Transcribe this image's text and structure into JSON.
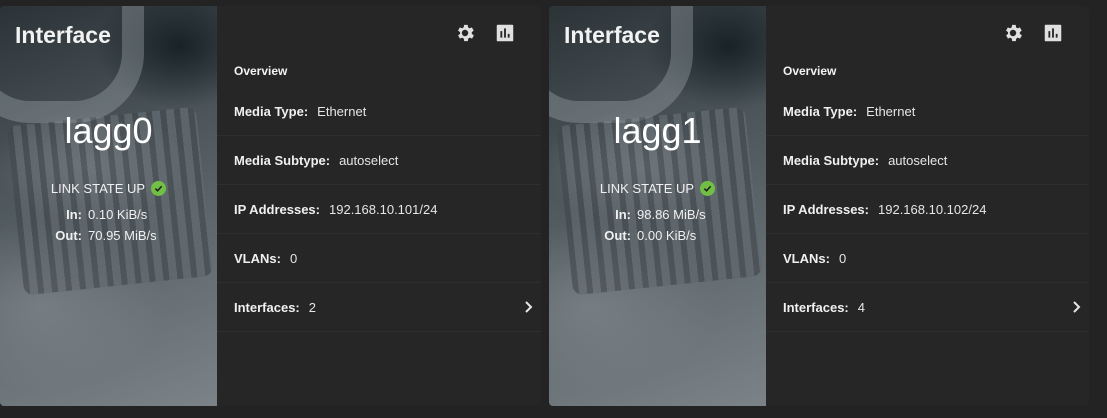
{
  "cards": [
    {
      "title": "Interface",
      "name": "lagg0",
      "link_state": "LINK STATE UP",
      "in_label": "In:",
      "in_value": "0.10 KiB/s",
      "out_label": "Out:",
      "out_value": "70.95 MiB/s",
      "overview": "Overview",
      "media_type_label": "Media Type:",
      "media_type": "Ethernet",
      "media_subtype_label": "Media Subtype:",
      "media_subtype": "autoselect",
      "ip_label": "IP Addresses:",
      "ip": "192.168.10.101/24",
      "vlans_label": "VLANs:",
      "vlans": "0",
      "interfaces_label": "Interfaces:",
      "interfaces": "2"
    },
    {
      "title": "Interface",
      "name": "lagg1",
      "link_state": "LINK STATE UP",
      "in_label": "In:",
      "in_value": "98.86 MiB/s",
      "out_label": "Out:",
      "out_value": "0.00 KiB/s",
      "overview": "Overview",
      "media_type_label": "Media Type:",
      "media_type": "Ethernet",
      "media_subtype_label": "Media Subtype:",
      "media_subtype": "autoselect",
      "ip_label": "IP Addresses:",
      "ip": "192.168.10.102/24",
      "vlans_label": "VLANs:",
      "vlans": "0",
      "interfaces_label": "Interfaces:",
      "interfaces": "4"
    }
  ],
  "icons": {
    "settings": "gear-icon",
    "reports": "bar-chart-icon",
    "link_ok": "check-circle-icon",
    "expand": "chevron-right-icon"
  },
  "colors": {
    "card_bg": "#262626",
    "page_bg": "#232323",
    "status_ok": "#71bf44"
  }
}
